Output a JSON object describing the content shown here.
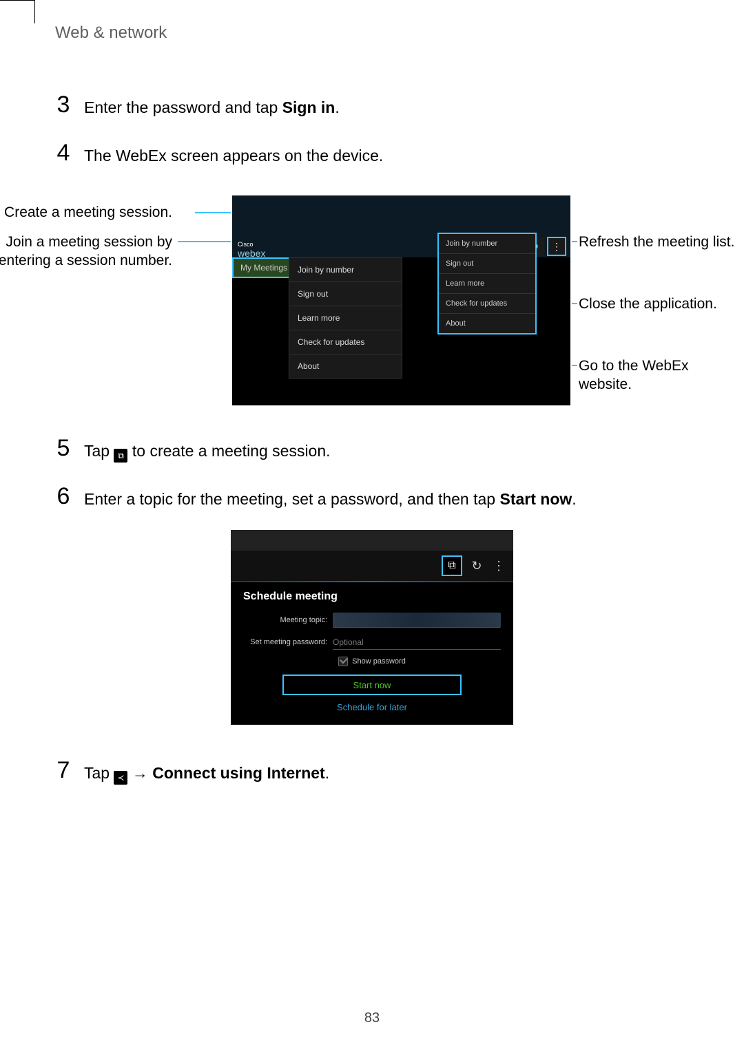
{
  "header": {
    "title": "Web & network"
  },
  "steps": {
    "s3": {
      "num": "3",
      "pre": "Enter the password and tap ",
      "bold": "Sign in",
      "post": "."
    },
    "s4": {
      "num": "4",
      "text": "The WebEx screen appears on the device."
    },
    "s5": {
      "num": "5",
      "pre": "Tap ",
      "post": " to create a meeting session."
    },
    "s6": {
      "num": "6",
      "pre": "Enter a topic for the meeting, set a password, and then tap ",
      "bold": "Start now",
      "post": "."
    },
    "s7": {
      "num": "7",
      "pre": "Tap ",
      "arrow": " → ",
      "bold": "Connect using Internet",
      "post": "."
    }
  },
  "annotations": {
    "left1": "Create a meeting session.",
    "left2": "Join a meeting session by entering a session number.",
    "right1": "Refresh the meeting list.",
    "right2": "Close the application.",
    "right3": "Go to the WebEx website."
  },
  "shot1": {
    "logo_top": "Cisco",
    "logo": "webex",
    "tab": "My Meetings",
    "menu": [
      "Join by number",
      "Sign out",
      "Learn more",
      "Check for updates",
      "About"
    ],
    "overlay": [
      "Join by number",
      "Sign out",
      "Learn more",
      "Check for updates",
      "About"
    ],
    "icons": {
      "create": "⧉",
      "refresh": "↻",
      "more": "⋮"
    }
  },
  "shot2": {
    "title": "Schedule meeting",
    "topic_label": "Meeting topic:",
    "pwd_label": "Set meeting password:",
    "pwd_placeholder": "Optional",
    "show_pwd": "Show password",
    "start": "Start now",
    "later": "Schedule for later",
    "icons": {
      "create": "⧉",
      "refresh": "↻",
      "more": "⋮"
    }
  },
  "inline_icons": {
    "create": "⧉",
    "share": "≺"
  },
  "page_number": "83"
}
